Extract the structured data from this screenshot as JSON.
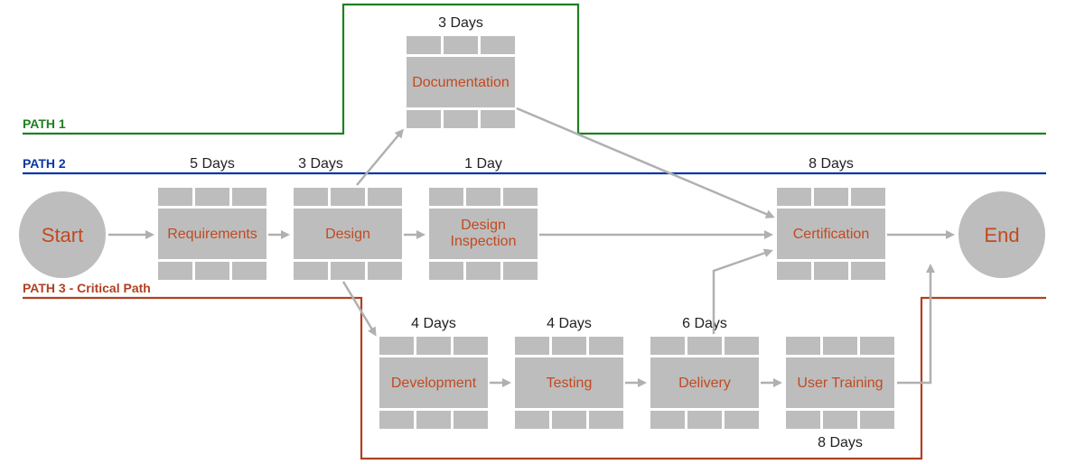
{
  "paths": {
    "path1": {
      "label": "PATH 1",
      "color": "#1e8020"
    },
    "path2": {
      "label": "PATH 2",
      "color": "#0b35a6"
    },
    "path3": {
      "label": "PATH 3 - Critical Path",
      "color": "#b14022"
    }
  },
  "endpoints": {
    "start": "Start",
    "end": "End"
  },
  "tasks": {
    "requirements": {
      "title": "Requirements",
      "duration": "5 Days"
    },
    "design": {
      "title": "Design",
      "duration": "3 Days"
    },
    "documentation": {
      "title": "Documentation",
      "duration": "3 Days"
    },
    "design_inspection": {
      "title": "Design Inspection",
      "duration": "1 Day"
    },
    "certification": {
      "title": "Certification",
      "duration": "8 Days"
    },
    "development": {
      "title": "Development",
      "duration": "4 Days"
    },
    "testing": {
      "title": "Testing",
      "duration": "4 Days"
    },
    "delivery": {
      "title": "Delivery",
      "duration": "6 Days"
    },
    "user_training": {
      "title": "User Training",
      "duration": "8 Days"
    }
  }
}
